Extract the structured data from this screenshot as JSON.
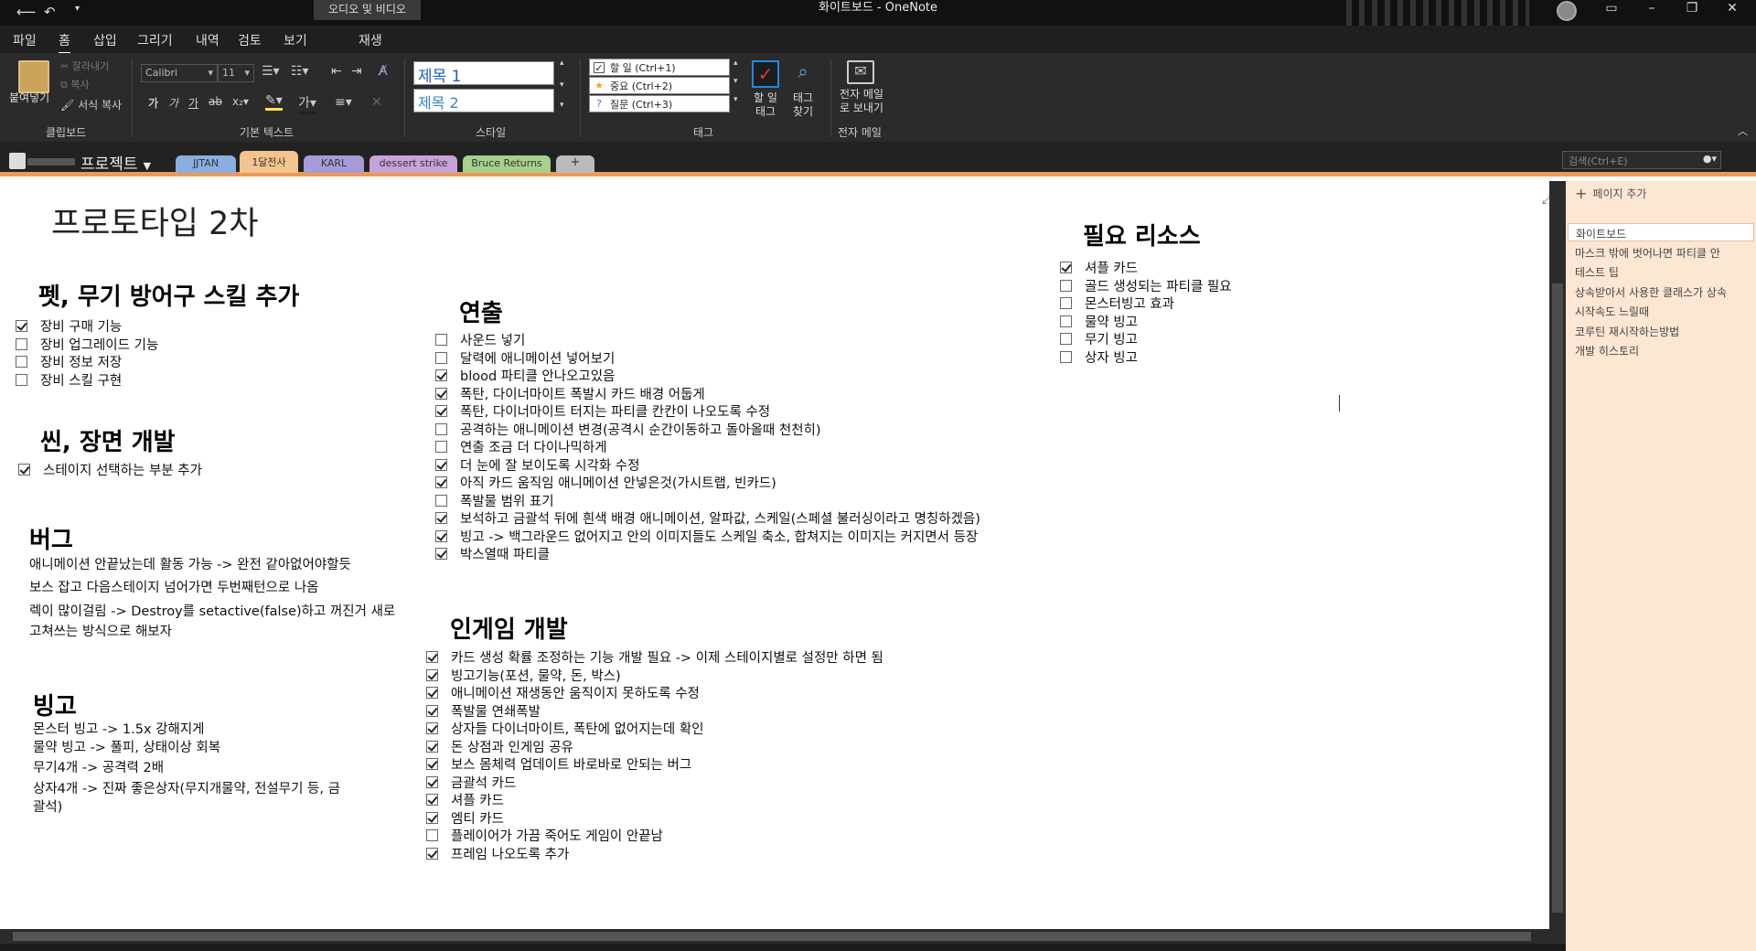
{
  "titlebar": {
    "context_tab": "오디오 및 비디오",
    "title": "화이트보드 - OneNote"
  },
  "menu": [
    "파일",
    "홈",
    "삽입",
    "그리기",
    "내역",
    "검토",
    "보기",
    "재생"
  ],
  "ribbon": {
    "clipboard": {
      "paste": "붙여넣기",
      "cut": "잘라내기",
      "copy": "복사",
      "format_painter": "서식 복사",
      "label": "클립보드"
    },
    "basic_text": {
      "font": "Calibri",
      "size": "11",
      "label": "기본 텍스트"
    },
    "styles": {
      "heading1": "제목 1",
      "heading2": "제목 2",
      "label": "스타일"
    },
    "tags": {
      "todo": "할 일 (Ctrl+1)",
      "important": "중요 (Ctrl+2)",
      "question": "질문 (Ctrl+3)",
      "todo_tag": "할 일\n태그",
      "find_tags": "태그\n찾기",
      "label": "태그"
    },
    "email": {
      "send": "전자 메일\n로 보내기",
      "label": "전자 메일"
    }
  },
  "notebook": {
    "name": "프로젝트",
    "sections": [
      {
        "label": "JJTAN",
        "color": "#8aaee0"
      },
      {
        "label": "1달전사",
        "color": "#f5c48e"
      },
      {
        "label": "KARL",
        "color": "#a99ad8"
      },
      {
        "label": "dessert strike",
        "color": "#c7a3d9"
      },
      {
        "label": "Bruce Returns",
        "color": "#a8d08d"
      },
      {
        "label": "+",
        "color": "#bbbbbb"
      }
    ],
    "search_placeholder": "검색(Ctrl+E)"
  },
  "page": {
    "title": "프로토타입 2차",
    "pet": {
      "heading": "펫, 무기 방어구 스킬 추가",
      "items": [
        {
          "text": "장비 구매 기능",
          "checked": true
        },
        {
          "text": "장비 업그레이드 기능",
          "checked": false
        },
        {
          "text": "장비 정보 저장",
          "checked": false
        },
        {
          "text": "장비 스킬 구현",
          "checked": false
        }
      ]
    },
    "scene": {
      "heading": "씬, 장면 개발",
      "items": [
        {
          "text": "스테이지 선택하는 부분 추가",
          "checked": true
        }
      ]
    },
    "bug": {
      "heading": "버그",
      "lines": [
        "애니메이션 안끝났는데 활동 가능 -> 완전 같아없어야할듯",
        "보스 잡고 다음스테이지 넘어가면 두번째턴으로 나옴",
        "렉이 많이걸림 -> Destroy를 setactive(false)하고 꺼진거 새로",
        "고쳐쓰는 방식으로 해보자"
      ]
    },
    "bingo": {
      "heading": "빙고",
      "lines": [
        "몬스터 빙고 -> 1.5x 강해지게",
        "물약 빙고 -> 풀피, 상태이상 회복",
        "무기4개 -> 공격력 2배",
        "상자4개 -> 진짜 좋은상자(무지개물약, 전설무기 등, 금",
        "괄석)"
      ]
    },
    "direction": {
      "heading": "연출",
      "items": [
        {
          "text": "사운드 넣기",
          "checked": false
        },
        {
          "text": "달력에 애니메이션 넣어보기",
          "checked": false
        },
        {
          "text": "blood 파티클 안나오고있음",
          "checked": true
        },
        {
          "text": "폭탄, 다이너마이트 폭발시 카드 배경 어둡게",
          "checked": true
        },
        {
          "text": "폭탄, 다이너마이트 터지는 파티클 칸칸이 나오도록 수정",
          "checked": true
        },
        {
          "text": "공격하는 애니메이션 변경(공격시 순간이동하고 돌아올때 천천히)",
          "checked": false
        },
        {
          "text": "연출 조금 더 다이나믹하게",
          "checked": false
        },
        {
          "text": "더 눈에 잘 보이도록 시각화 수정",
          "checked": true
        },
        {
          "text": "아직 카드 움직임 애니메이션 안넣은것(가시트랩, 빈카드)",
          "checked": true
        },
        {
          "text": "폭발물 범위 표기",
          "checked": false
        },
        {
          "text": "보석하고 금괄석 뒤에 흰색 배경 애니메이션, 알파값, 스케일(스페셜 불러싱이라고 명칭하겠음)",
          "checked": true
        },
        {
          "text": "빙고 -> 백그라운드 없어지고 안의 이미지들도 스케일 축소, 합쳐지는 이미지는 커지면서 등장",
          "checked": true
        },
        {
          "text": "박스열때 파티클",
          "checked": true
        }
      ]
    },
    "ingame": {
      "heading": "인게임 개발",
      "items": [
        {
          "text": "카드 생성 확률 조정하는 기능 개발 필요 -> 이제 스테이지별로 설정만 하면 됨",
          "checked": true
        },
        {
          "text": "빙고기능(포션, 물약, 돈, 박스)",
          "checked": true
        },
        {
          "text": "애니메이션 재생동안 움직이지 못하도록 수정",
          "checked": true
        },
        {
          "text": "폭발물 연쇄폭발",
          "checked": true
        },
        {
          "text": "상자들 다이너마이트, 폭탄에 없어지는데 확인",
          "checked": true
        },
        {
          "text": "돈 상점과 인게임 공유",
          "checked": true
        },
        {
          "text": "보스 몸체력 업데이트 바로바로 안되는 버그",
          "checked": true
        },
        {
          "text": "금괄석 카드",
          "checked": true
        },
        {
          "text": "셔플 카드",
          "checked": true
        },
        {
          "text": "엠티 카드",
          "checked": true
        },
        {
          "text": "플레이어가 가끔 죽어도 게임이 안끝남",
          "checked": false
        },
        {
          "text": "프레임 나오도록 추가",
          "checked": true
        }
      ]
    },
    "resources": {
      "heading": "필요 리소스",
      "items": [
        {
          "text": "셔플 카드",
          "checked": true
        },
        {
          "text": "골드 생성되는 파티클 필요",
          "checked": false
        },
        {
          "text": "몬스터빙고 효과",
          "checked": false
        },
        {
          "text": "물약 빙고",
          "checked": false
        },
        {
          "text": "무기 빙고",
          "checked": false
        },
        {
          "text": "상자 빙고",
          "checked": false
        }
      ]
    }
  },
  "page_list": {
    "add_label": "페이지 추가",
    "pages": [
      "화이트보드",
      "마스크 밖에 벗어나면 파티클 안",
      "테스트 팁",
      "상속받아서 사용한 클래스가 상속",
      "시작속도 느릴때",
      "코루틴 재시작하는방법",
      "개발 히스토리"
    ]
  },
  "colors": {
    "accent": "#e89b5a",
    "panel": "#fde6d2",
    "ribbon": "#2b2b2b"
  }
}
